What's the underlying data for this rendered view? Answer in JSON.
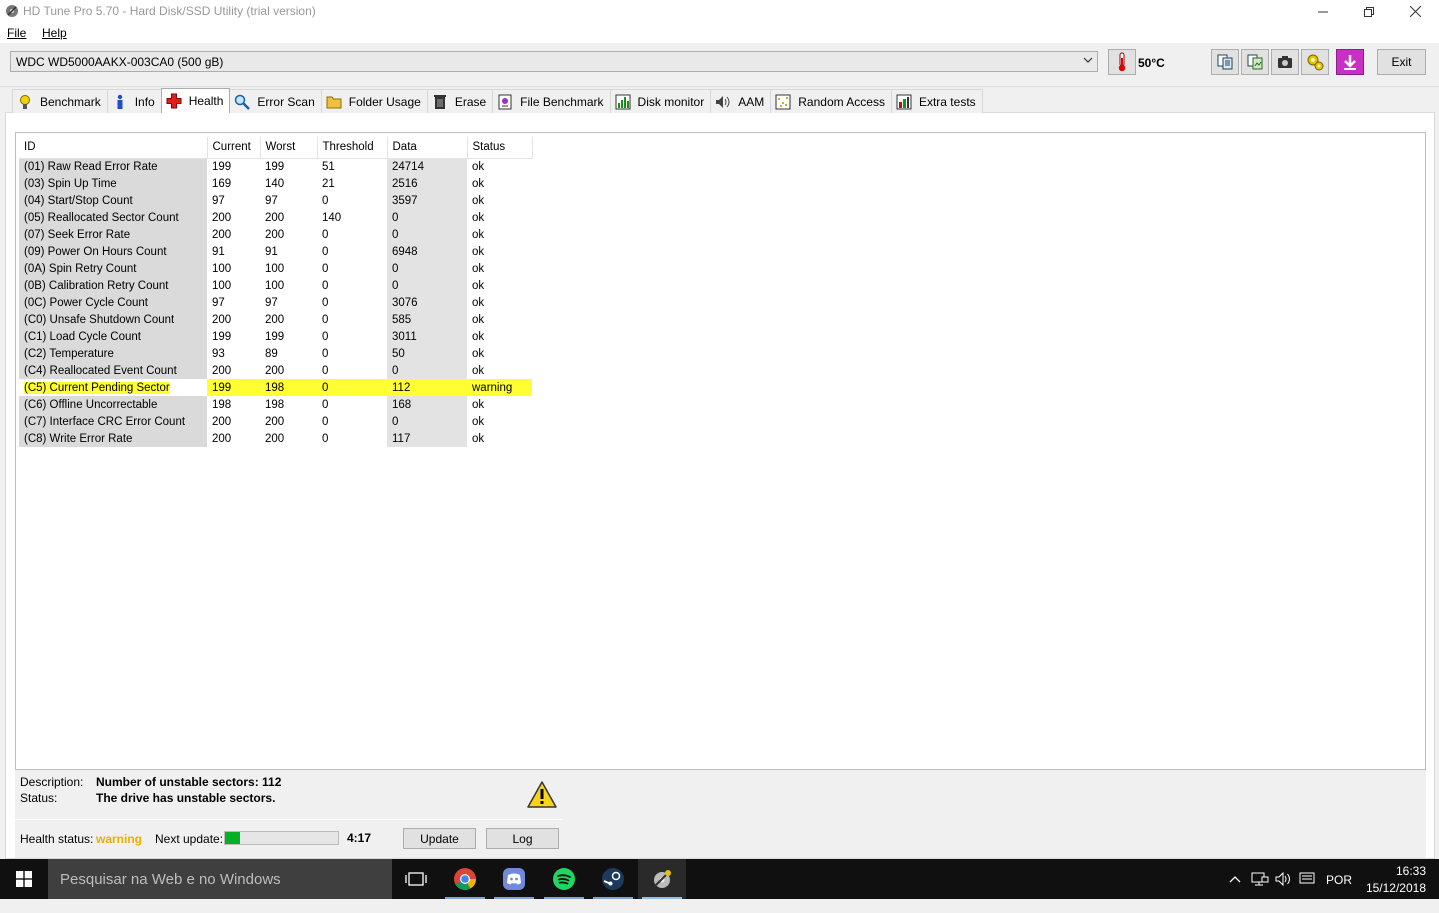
{
  "window": {
    "title": "HD Tune Pro 5.70 - Hard Disk/SSD Utility (trial version)",
    "controls": {
      "minimize": "minimize-icon",
      "restore": "restore-icon",
      "close": "close-icon"
    }
  },
  "menu": {
    "file": "File",
    "help": "Help"
  },
  "toolbar": {
    "drive": "WDC WD5000AAKX-003CA0 (500 gB)",
    "temperature": "50°C",
    "exit_label": "Exit",
    "buttons": [
      "copy-text-icon",
      "copy-screenshot-icon",
      "camera-icon",
      "options-icon",
      "save-icon"
    ]
  },
  "tabs": [
    {
      "label": "Benchmark",
      "icon": "benchmark-icon"
    },
    {
      "label": "Info",
      "icon": "info-icon"
    },
    {
      "label": "Health",
      "icon": "health-cross-icon",
      "active": true
    },
    {
      "label": "Error Scan",
      "icon": "magnifier-icon"
    },
    {
      "label": "Folder Usage",
      "icon": "folder-icon"
    },
    {
      "label": "Erase",
      "icon": "trash-icon"
    },
    {
      "label": "File Benchmark",
      "icon": "file-benchmark-icon"
    },
    {
      "label": "Disk monitor",
      "icon": "disk-monitor-icon"
    },
    {
      "label": "AAM",
      "icon": "speaker-icon"
    },
    {
      "label": "Random Access",
      "icon": "random-access-icon"
    },
    {
      "label": "Extra tests",
      "icon": "extra-tests-icon"
    }
  ],
  "health": {
    "columns": [
      "ID",
      "Current",
      "Worst",
      "Threshold",
      "Data",
      "Status"
    ],
    "rows": [
      {
        "id": "(01) Raw Read Error Rate",
        "current": "199",
        "worst": "199",
        "threshold": "51",
        "data": "24714",
        "status": "ok"
      },
      {
        "id": "(03) Spin Up Time",
        "current": "169",
        "worst": "140",
        "threshold": "21",
        "data": "2516",
        "status": "ok"
      },
      {
        "id": "(04) Start/Stop Count",
        "current": "97",
        "worst": "97",
        "threshold": "0",
        "data": "3597",
        "status": "ok"
      },
      {
        "id": "(05) Reallocated Sector Count",
        "current": "200",
        "worst": "200",
        "threshold": "140",
        "data": "0",
        "status": "ok"
      },
      {
        "id": "(07) Seek Error Rate",
        "current": "200",
        "worst": "200",
        "threshold": "0",
        "data": "0",
        "status": "ok"
      },
      {
        "id": "(09) Power On Hours Count",
        "current": "91",
        "worst": "91",
        "threshold": "0",
        "data": "6948",
        "status": "ok"
      },
      {
        "id": "(0A) Spin Retry Count",
        "current": "100",
        "worst": "100",
        "threshold": "0",
        "data": "0",
        "status": "ok"
      },
      {
        "id": "(0B) Calibration Retry Count",
        "current": "100",
        "worst": "100",
        "threshold": "0",
        "data": "0",
        "status": "ok"
      },
      {
        "id": "(0C) Power Cycle Count",
        "current": "97",
        "worst": "97",
        "threshold": "0",
        "data": "3076",
        "status": "ok"
      },
      {
        "id": "(C0) Unsafe Shutdown Count",
        "current": "200",
        "worst": "200",
        "threshold": "0",
        "data": "585",
        "status": "ok"
      },
      {
        "id": "(C1) Load Cycle Count",
        "current": "199",
        "worst": "199",
        "threshold": "0",
        "data": "3011",
        "status": "ok"
      },
      {
        "id": "(C2) Temperature",
        "current": "93",
        "worst": "89",
        "threshold": "0",
        "data": "50",
        "status": "ok"
      },
      {
        "id": "(C4) Reallocated Event Count",
        "current": "200",
        "worst": "200",
        "threshold": "0",
        "data": "0",
        "status": "ok"
      },
      {
        "id": "(C5) Current Pending Sector",
        "current": "199",
        "worst": "198",
        "threshold": "0",
        "data": "112",
        "status": "warning",
        "highlight": true
      },
      {
        "id": "(C6) Offline Uncorrectable",
        "current": "198",
        "worst": "198",
        "threshold": "0",
        "data": "168",
        "status": "ok"
      },
      {
        "id": "(C7) Interface CRC Error Count",
        "current": "200",
        "worst": "200",
        "threshold": "0",
        "data": "0",
        "status": "ok"
      },
      {
        "id": "(C8) Write Error Rate",
        "current": "200",
        "worst": "200",
        "threshold": "0",
        "data": "117",
        "status": "ok"
      }
    ],
    "highlight_color": "#ffff33"
  },
  "details": {
    "description_label": "Description:",
    "description_value": "Number of unstable sectors: 112",
    "status_label": "Status:",
    "status_value": "The drive has unstable sectors.",
    "warning_icon": "warning-triangle-icon"
  },
  "footer": {
    "health_status_label": "Health status:",
    "health_status_value": "warning",
    "health_status_color": "#e8b000",
    "next_update_label": "Next update:",
    "next_update_progress": 0.13,
    "next_update_time": "4:17",
    "update_button": "Update",
    "log_button": "Log"
  },
  "taskbar": {
    "search_placeholder": "Pesquisar na Web e no Windows",
    "apps": [
      "task-view-icon",
      "chrome-icon",
      "discord-icon",
      "spotify-icon",
      "steam-icon",
      "hdtune-icon"
    ],
    "language": "POR",
    "time": "16:33",
    "date": "15/12/2018"
  }
}
